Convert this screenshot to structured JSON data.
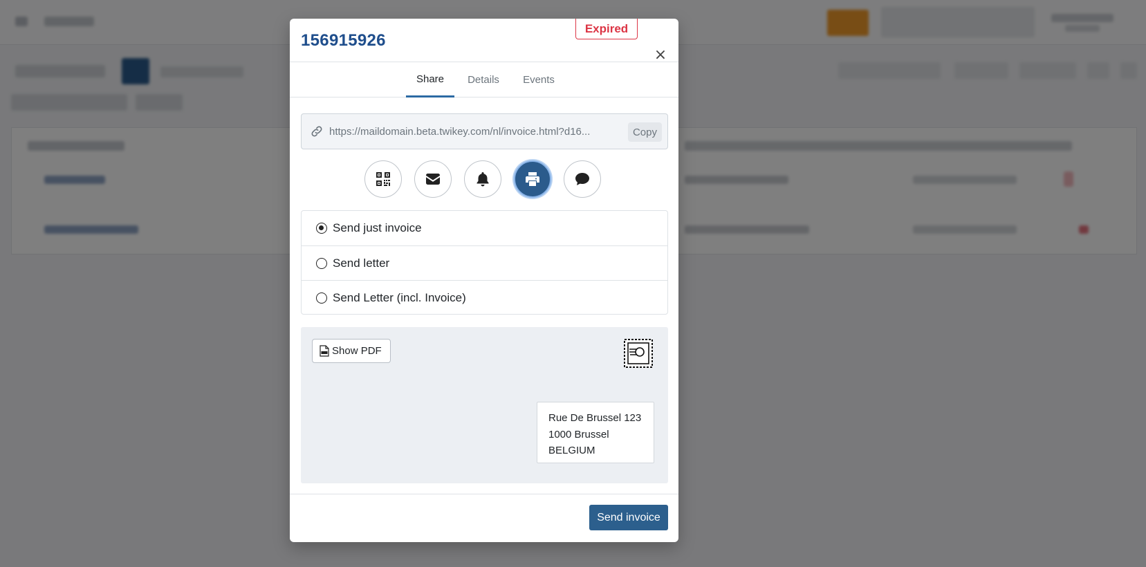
{
  "modal": {
    "title": "156915926",
    "status_badge": "Expired",
    "close_symbol": "×",
    "tabs": [
      {
        "label": "Share",
        "active": true
      },
      {
        "label": "Details",
        "active": false
      },
      {
        "label": "Events",
        "active": false
      }
    ],
    "share": {
      "url": "https://maildomain.beta.twikey.com/nl/invoice.html?d16...",
      "copy_label": "Copy",
      "link_icon": "link-icon",
      "channels": [
        {
          "icon": "qr-code-icon",
          "active": false
        },
        {
          "icon": "envelope-icon",
          "active": false
        },
        {
          "icon": "bell-icon",
          "active": false
        },
        {
          "icon": "printer-icon",
          "active": true
        },
        {
          "icon": "chat-icon",
          "active": false
        }
      ],
      "options": [
        {
          "label": "Send just invoice",
          "checked": true
        },
        {
          "label": "Send letter",
          "checked": false
        },
        {
          "label": "Send Letter (incl. Invoice)",
          "checked": false
        }
      ],
      "preview": {
        "show_pdf_label": "Show PDF",
        "stamp_icon": "postage-stamp-icon",
        "address_lines": [
          "Rue De Brussel 123",
          "1000 Brussel",
          "BELGIUM"
        ]
      }
    },
    "footer": {
      "send_label": "Send invoice"
    }
  },
  "colors": {
    "title": "#1f4e8c",
    "expired": "#dc3545",
    "primary": "#2c5f8d",
    "active_channel": "#2b5b8c"
  }
}
